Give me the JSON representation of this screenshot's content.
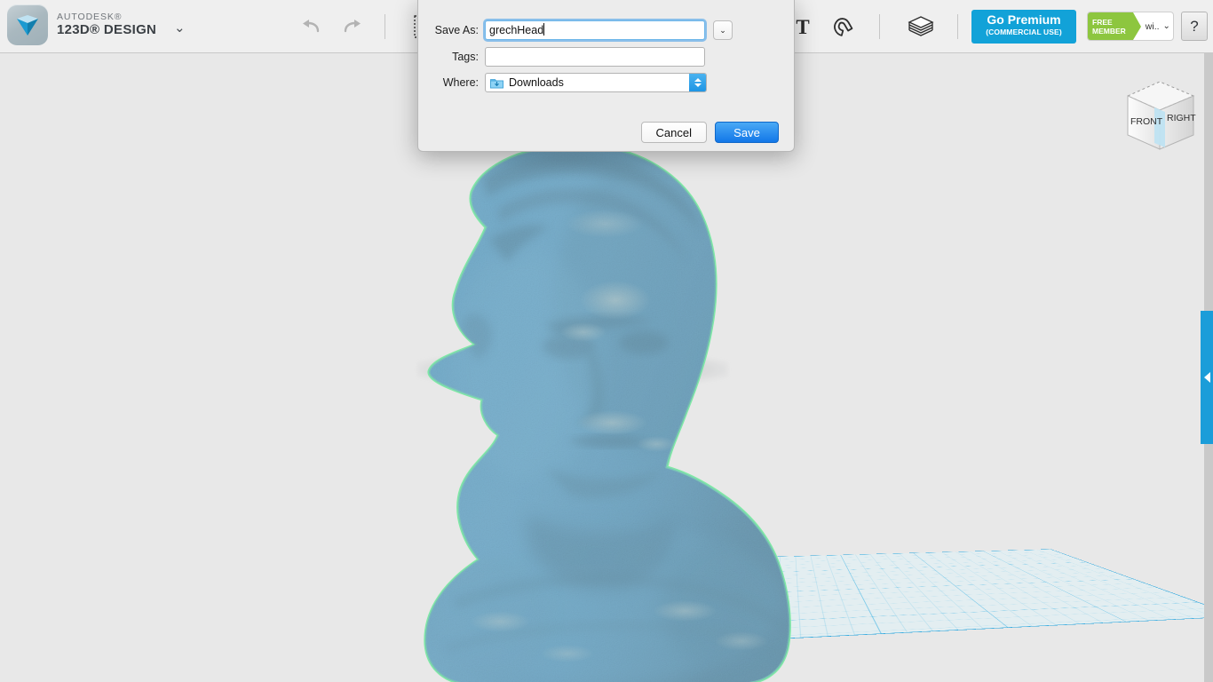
{
  "app": {
    "brand_top": "AUTODESK®",
    "brand_main": "123D® DESIGN",
    "brand_caret": "⌄"
  },
  "toolbar": {
    "undo_icon": "undo-arrow-icon",
    "redo_icon": "redo-arrow-icon",
    "text_tool_label": "T",
    "snap_icon": "magnet-icon",
    "layers_icon": "layers-stack-icon",
    "go_premium_line1": "Go Premium",
    "go_premium_line2": "(COMMERCIAL USE)",
    "member_badge_line1": "FREE",
    "member_badge_line2": "MEMBER",
    "member_user": "wi..",
    "member_caret": "⌄",
    "help_label": "?"
  },
  "viewport": {
    "viewcube_front": "FRONT",
    "viewcube_right": "RIGHT",
    "panel_tab_icon": "collapse-panel-arrow-icon",
    "model_name": "scanned-bust-model"
  },
  "dialog": {
    "save_as_label": "Save As:",
    "save_as_value": "grechHead",
    "save_as_placeholder": "",
    "tags_label": "Tags:",
    "tags_value": "",
    "tags_placeholder": "",
    "where_label": "Where:",
    "where_value": "Downloads",
    "expand_caret": "⌄",
    "cancel_label": "Cancel",
    "save_label": "Save"
  },
  "colors": {
    "accent_blue": "#12a2d8",
    "save_blue": "#1277e8",
    "member_green": "#8dc63f",
    "grid_blue": "#1fa2dd",
    "selection_green": "#7fe8a6",
    "model_blue": "#6aa8c9",
    "toolbar_bg": "#efefef",
    "viewport_bg": "#e8e8e8",
    "dialog_bg": "#ececec"
  }
}
